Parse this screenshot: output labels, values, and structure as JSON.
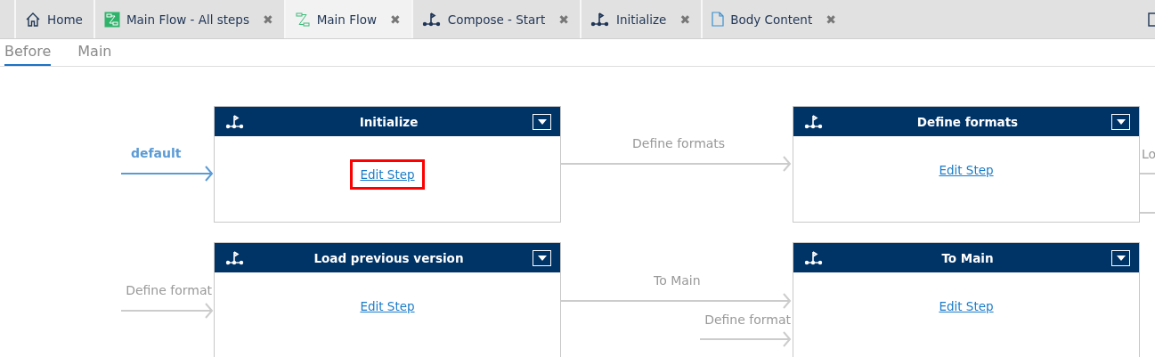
{
  "tabs": [
    {
      "label": "Home",
      "kind": "home",
      "closable": false,
      "selected": false
    },
    {
      "label": "Main Flow - All steps",
      "kind": "flow-filled",
      "closable": true,
      "selected": false
    },
    {
      "label": "Main Flow",
      "kind": "flow",
      "closable": true,
      "selected": true
    },
    {
      "label": "Compose - Start",
      "kind": "step",
      "closable": true,
      "selected": false
    },
    {
      "label": "Initialize",
      "kind": "step",
      "closable": true,
      "selected": false
    },
    {
      "label": "Body Content",
      "kind": "document",
      "closable": true,
      "selected": false
    }
  ],
  "close_glyph": "✖",
  "sub_tabs": [
    {
      "label": "Before",
      "selected": true
    },
    {
      "label": "Main",
      "selected": false
    }
  ],
  "nodes": [
    {
      "title": "Initialize",
      "link": "Edit Step",
      "highlighted": true
    },
    {
      "title": "Define formats",
      "link": "Edit Step",
      "highlighted": false
    },
    {
      "title": "Load previous version",
      "link": "Edit Step",
      "highlighted": false
    },
    {
      "title": "To Main",
      "link": "Edit Step",
      "highlighted": false
    }
  ],
  "edges": [
    {
      "label": "default",
      "kind": "default"
    },
    {
      "label": "Define formats",
      "kind": "normal"
    },
    {
      "label": "Lo",
      "kind": "normal"
    },
    {
      "label": "Define format",
      "kind": "normal"
    },
    {
      "label": "To Main",
      "kind": "normal"
    },
    {
      "label": "Define format",
      "kind": "normal"
    }
  ]
}
